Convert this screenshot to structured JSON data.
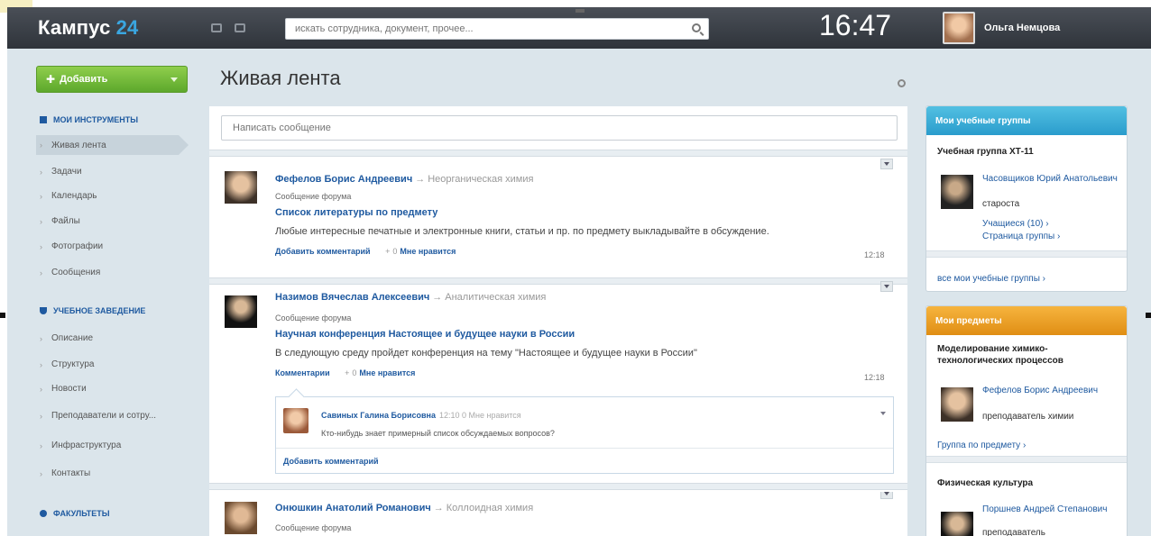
{
  "header": {
    "logo_text": "Кампус",
    "logo_num": "24",
    "search_placeholder": "искать сотрудника, документ, прочее...",
    "clock": "16:47",
    "user_name": "Ольга Немцова"
  },
  "sidebar": {
    "add_button": "Добавить",
    "tools_title": "МОИ ИНСТРУМЕНТЫ",
    "tools": [
      "Живая лента",
      "Задачи",
      "Календарь",
      "Файлы",
      "Фотографии",
      "Сообщения"
    ],
    "school_title": "УЧЕБНОЕ ЗАВЕДЕНИЕ",
    "school": [
      "Описание",
      "Структура",
      "Новости",
      "Преподаватели и сотру...",
      "Инфраструктура",
      "Контакты"
    ],
    "faculties_title": "ФАКУЛЬТЕТЫ"
  },
  "feed": {
    "title": "Живая лента",
    "compose_placeholder": "Написать сообщение",
    "posts": [
      {
        "author": "Фефелов Борис Андреевич",
        "arrow": "→",
        "subject": "Неорганическая химия",
        "type": "Сообщение форума",
        "title": "Список литературы по предмету",
        "text": "Любые интересные печатные и электронные книги, статьи и пр. по предмету выкладывайте в обсуждение.",
        "comment_label": "Добавить комментарий",
        "likes_count": "0",
        "likes_label": "Мне нравится",
        "time": "12:18"
      },
      {
        "author": "Назимов Вячеслав Алексеевич",
        "arrow": "→",
        "subject": "Аналитическая химия",
        "type": "Сообщение форума",
        "title": "Научная конференция Настоящее и будущее науки в России",
        "text": "В следующую среду пройдет конференция на тему \"Настоящее и будущее науки в России\"",
        "comment_label": "Комментарии",
        "likes_count": "0",
        "likes_label": "Мне нравится",
        "time": "12:18"
      },
      {
        "author": "Онюшкин Анатолий Романович",
        "arrow": "→",
        "subject": "Коллоидная химия",
        "type": "Сообщение форума"
      }
    ],
    "comment": {
      "author": "Савиных Галина Борисовна",
      "meta": "12:10  0 Мне нравится",
      "text": "Кто-нибудь знает примерный список обсуждаемых вопросов?",
      "add_label": "Добавить комментарий"
    }
  },
  "widgets": {
    "groups": {
      "title": "Мои учебные группы",
      "group_name": "Учебная группа ХТ-11",
      "person_name": "Часовщиков Юрий Анатольевич",
      "person_role": "староста",
      "students_link": "Учащиеся (10) ›",
      "group_page_link": "Страница группы ›",
      "all_groups_link": "все мои учебные группы ›"
    },
    "subjects": {
      "title": "Мои предметы",
      "subject1": "Моделирование химико-технологических процессов",
      "teacher1_name": "Фефелов Борис Андреевич",
      "teacher1_role": "преподаватель химии",
      "group_link": "Группа по предмету ›",
      "subject2": "Физическая культура",
      "teacher2_name": "Поршнев Андрей Степанович",
      "teacher2_role": "преподаватель"
    }
  }
}
